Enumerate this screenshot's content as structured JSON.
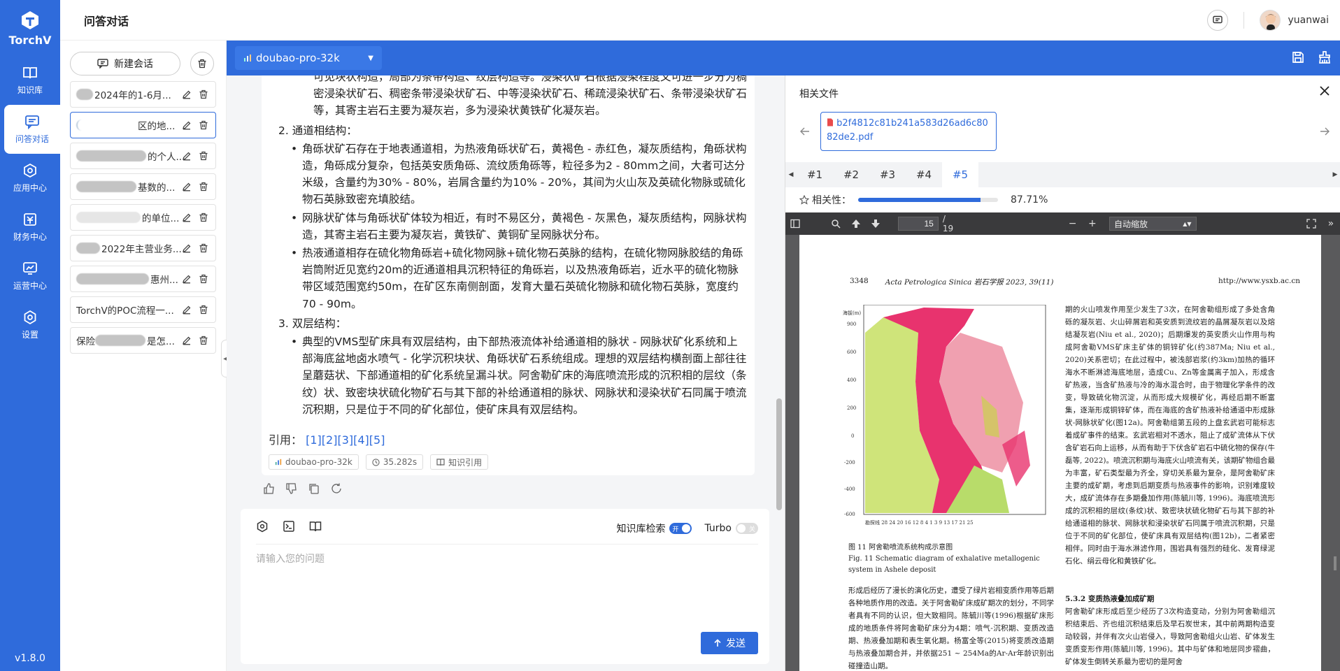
{
  "brand": {
    "name": "TorchV"
  },
  "nav": [
    {
      "label": "知识库",
      "icon": "book-icon"
    },
    {
      "label": "问答对话",
      "icon": "chat-icon",
      "active": true
    },
    {
      "label": "应用中心",
      "icon": "hexagon-icon"
    },
    {
      "label": "财务中心",
      "icon": "finance-icon"
    },
    {
      "label": "运营中心",
      "icon": "operations-icon"
    },
    {
      "label": "设置",
      "icon": "gear-icon"
    }
  ],
  "version": "v1.8.0",
  "header": {
    "title": "问答对话",
    "username": "yuanwai"
  },
  "sessions": {
    "new_label": "新建会话",
    "items": [
      {
        "title": "2024年的1-6月..."
      },
      {
        "title": "区的地..."
      },
      {
        "title": "的个人..."
      },
      {
        "title": "基数的..."
      },
      {
        "title": "的单位..."
      },
      {
        "title": "2022年主营业务..."
      },
      {
        "title": "惠州..."
      },
      {
        "title": "TorchV的POC流程一..."
      },
      {
        "title": "是怎..."
      }
    ],
    "item_prefix_9": "保险"
  },
  "model": {
    "name": "doubao-pro-32k"
  },
  "answer": {
    "p1": "可见块状构造，局部为条带构造、纹层构造等。浸染状矿石根据浸染程度又可进一步分为稠密浸染状矿石、稠密条带浸染状矿石、中等浸染状矿石、稀疏浸染状矿石、条带浸染状矿石等，其寄主岩石主要为凝灰岩，多为浸染状黄铁矿化凝灰岩。",
    "h2": "2. 通道相结构：",
    "b2_1": "角砾状矿石存在于地表通道相，为热液角砾状矿石，黄褐色 - 赤红色，凝灰质结构，角砾状构造，角砾成分复杂，包括英安质角砾、流纹质角砾等，粒径多为2 - 80mm之间，大者可达分米级，含量约为30% - 80%，岩屑含量约为10% - 20%，其间为火山灰及英硫化物脉或硫化物石英脉致密充填胶结。",
    "b2_2": "网脉状矿体与角砾状矿体较为相近，有时不易区分，黄褐色 - 灰黑色，凝灰质结构，网脉状构造，其寄主岩石主要为凝灰岩，黄铁矿、黄铜矿呈网脉状分布。",
    "b2_3": "热液通道相存在硫化物角砾岩+硫化物网脉+硫化物石英脉的结构，在硫化物网脉胶结的角砾岩筒附近见宽约20m的近通道相具沉积特征的角砾岩，以及热液角砾岩，近水平的硫化物脉带区域范围宽约50m，在矿区东南侧剖面，发育大量石英硫化物脉和硫化物石英脉，宽度约70 - 90m。",
    "h3": "3. 双层结构：",
    "b3_1": "典型的VMS型矿床具有双层结构，由下部热液流体补给通道相的脉状 - 网脉状矿化系统和上部海底盆地卤水喷气 - 化学沉积块状、角砾状矿石系统组成。理想的双层结构横剖面上部往往呈蘑菇状、下部通道相的矿化系统呈漏斗状。阿舍勒矿床的海底喷流形成的沉积相的层纹（条纹）状、致密块状硫化物矿石与其下部的补给通道相的脉状、网脉状和浸染状矿石同属于喷流沉积期，只是位于不同的矿化部位，使矿床具有双层结构。",
    "cite_label": "引用：",
    "citations": [
      "[1]",
      "[2]",
      "[3]",
      "[4]",
      "[5]"
    ],
    "tag_model": "doubao-pro-32k",
    "tag_time": "35.282s",
    "tag_kb": "知识引用"
  },
  "input": {
    "kb_search_label": "知识库检索",
    "kb_on": "开",
    "turbo_label": "Turbo",
    "turbo_off": "关",
    "placeholder": "请输入您的问题",
    "send_label": "发送"
  },
  "files": {
    "title": "相关文件",
    "file_name": "b2f4812c81b241a583d26ad6c8082de2.pdf",
    "tabs": [
      "#1",
      "#2",
      "#3",
      "#4",
      "#5"
    ],
    "active_tab": "#5",
    "relevance_label": "相关性：",
    "relevance_value": 0.8771,
    "relevance_text": "87.71%"
  },
  "pdf": {
    "page": "15",
    "total": "/ 19",
    "zoom": "自动缩放",
    "header_left": "3348",
    "header_mid": "Acta Petrologica Sinica  岩石学报  2023, 39(11)",
    "header_right": "http://www.ysxb.ac.cn",
    "fig_title": "图 11   阿舍勒喷流系统构成示意图",
    "fig_title_en": "Fig. 11   Schematic diagram of exhalative metallogenic system in Ashele deposit",
    "left_text": "形成后经历了漫长的演化历史，遭受了绿片岩相变质作用等后期各种地质作用的改造。关于阿舍勒矿床成矿期次的划分，不同学者具有不同的认识，但大致相同。陈毓川等(1996)根据矿床形成的地质条件将阿舍勒矿床分为4期：喷气-沉积期、变质改造期、热液叠加期和表生氧化期。杨富全等(2015)将变质改造期与热液叠加期合并，并依据251 ~ 254Ma的Ar-Ar年龄识别出碰撞造山期。",
    "right_text": "期的火山喷发作用至少发生了3次，在阿舍勒组形成了多处含角砾的凝灰岩、火山碎屑岩和英安质到流纹岩的晶屑凝灰岩以及熔结凝灰岩(Niu et al., 2020)；后期爆发的英安质火山作用与构成阿舍勒VMS矿床主矿体的铜锌矿化(约387Ma; Niu et al., 2020)关系密切；在此过程中，被浅部岩浆(约3km)加热的循环海水不断淋滤海底地层，造成Cu、Zn等金属离子加入，形成含矿热液，当含矿热液与冷的海水混合时，由于物理化学条件的改变，导致硫化物沉淀，从而形成大规模矿化，再经后期不断富集，逐渐形成铜锌矿体，而在海底的含矿热液补给通道中形成脉状-网脉状矿化(图12a)。阿舍勒组第五段的上盘玄武岩可能标志着成矿事件的结束。玄武岩相对不透水，阻止了成矿流体从下伏含矿岩石向上运移，从而有助于下伏含矿岩石中硫化物的保存(牛磊等, 2022)。喷流沉积期与海底火山喷流有关，该期矿物组合最为丰富，矿石类型最为齐全，穿切关系最为复杂，是阿舍勒矿床主要的成矿期，考虑到后期变质与热液事件的影响，识别难度较大，成矿流体存在多期叠加作用(陈毓川等, 1996)。海底喷流形成的沉积相的层纹(条纹)状、致密块状硫化物矿石与其下部的补给通道相的脉状、网脉状和浸染状矿石同属于喷流沉积期，只是位于不同的矿化部位，使矿床具有双层结构(图12b)，二者紧密相伴。同时由于海水淋滤作用，围岩具有强烈的硅化、发育绿泥石化、绢云母化和黄铁矿化。",
    "section": "5.3.2   变质热液叠加成矿期",
    "right_text2": "阿舍勒矿床形成后至少经历了3次构造变动，分别为阿舍勒组沉积结束后、齐也组沉积结束后及早石炭世末，其中前两期构造变动较弱，并伴有次火山岩侵入，导致阿舍勒组火山岩、矿体发生变质变形作用(陈毓川等, 1996)。其中与矿体和地层同步褶曲，矿体发生倒转关系最为密切的是阿舍"
  },
  "colors": {
    "brand": "#2f6bdb",
    "panel_bg": "#f4f5f7"
  }
}
